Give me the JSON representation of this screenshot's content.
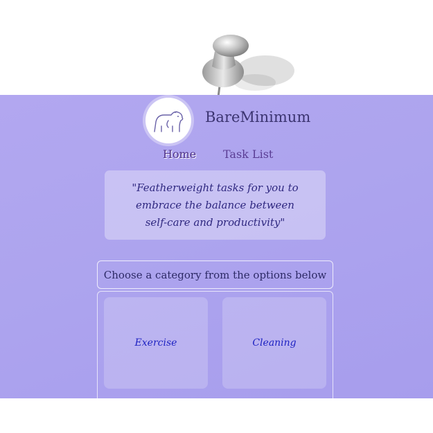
{
  "app": {
    "title": "BareMinimum"
  },
  "nav": {
    "items": [
      "Home",
      "Task List"
    ]
  },
  "quote": {
    "text": "\"Featherweight tasks for you to embrace the balance between self-care and productivity\""
  },
  "categories": {
    "prompt": "Choose a category from the options below",
    "options": [
      "Exercise",
      "Cleaning"
    ]
  },
  "icons": {
    "logo": "polar-bear-icon",
    "pin": "pushpin-icon"
  },
  "colors": {
    "background": "#ada4ee",
    "brand_text": "#3b3470",
    "option_text": "#1f23c2"
  }
}
